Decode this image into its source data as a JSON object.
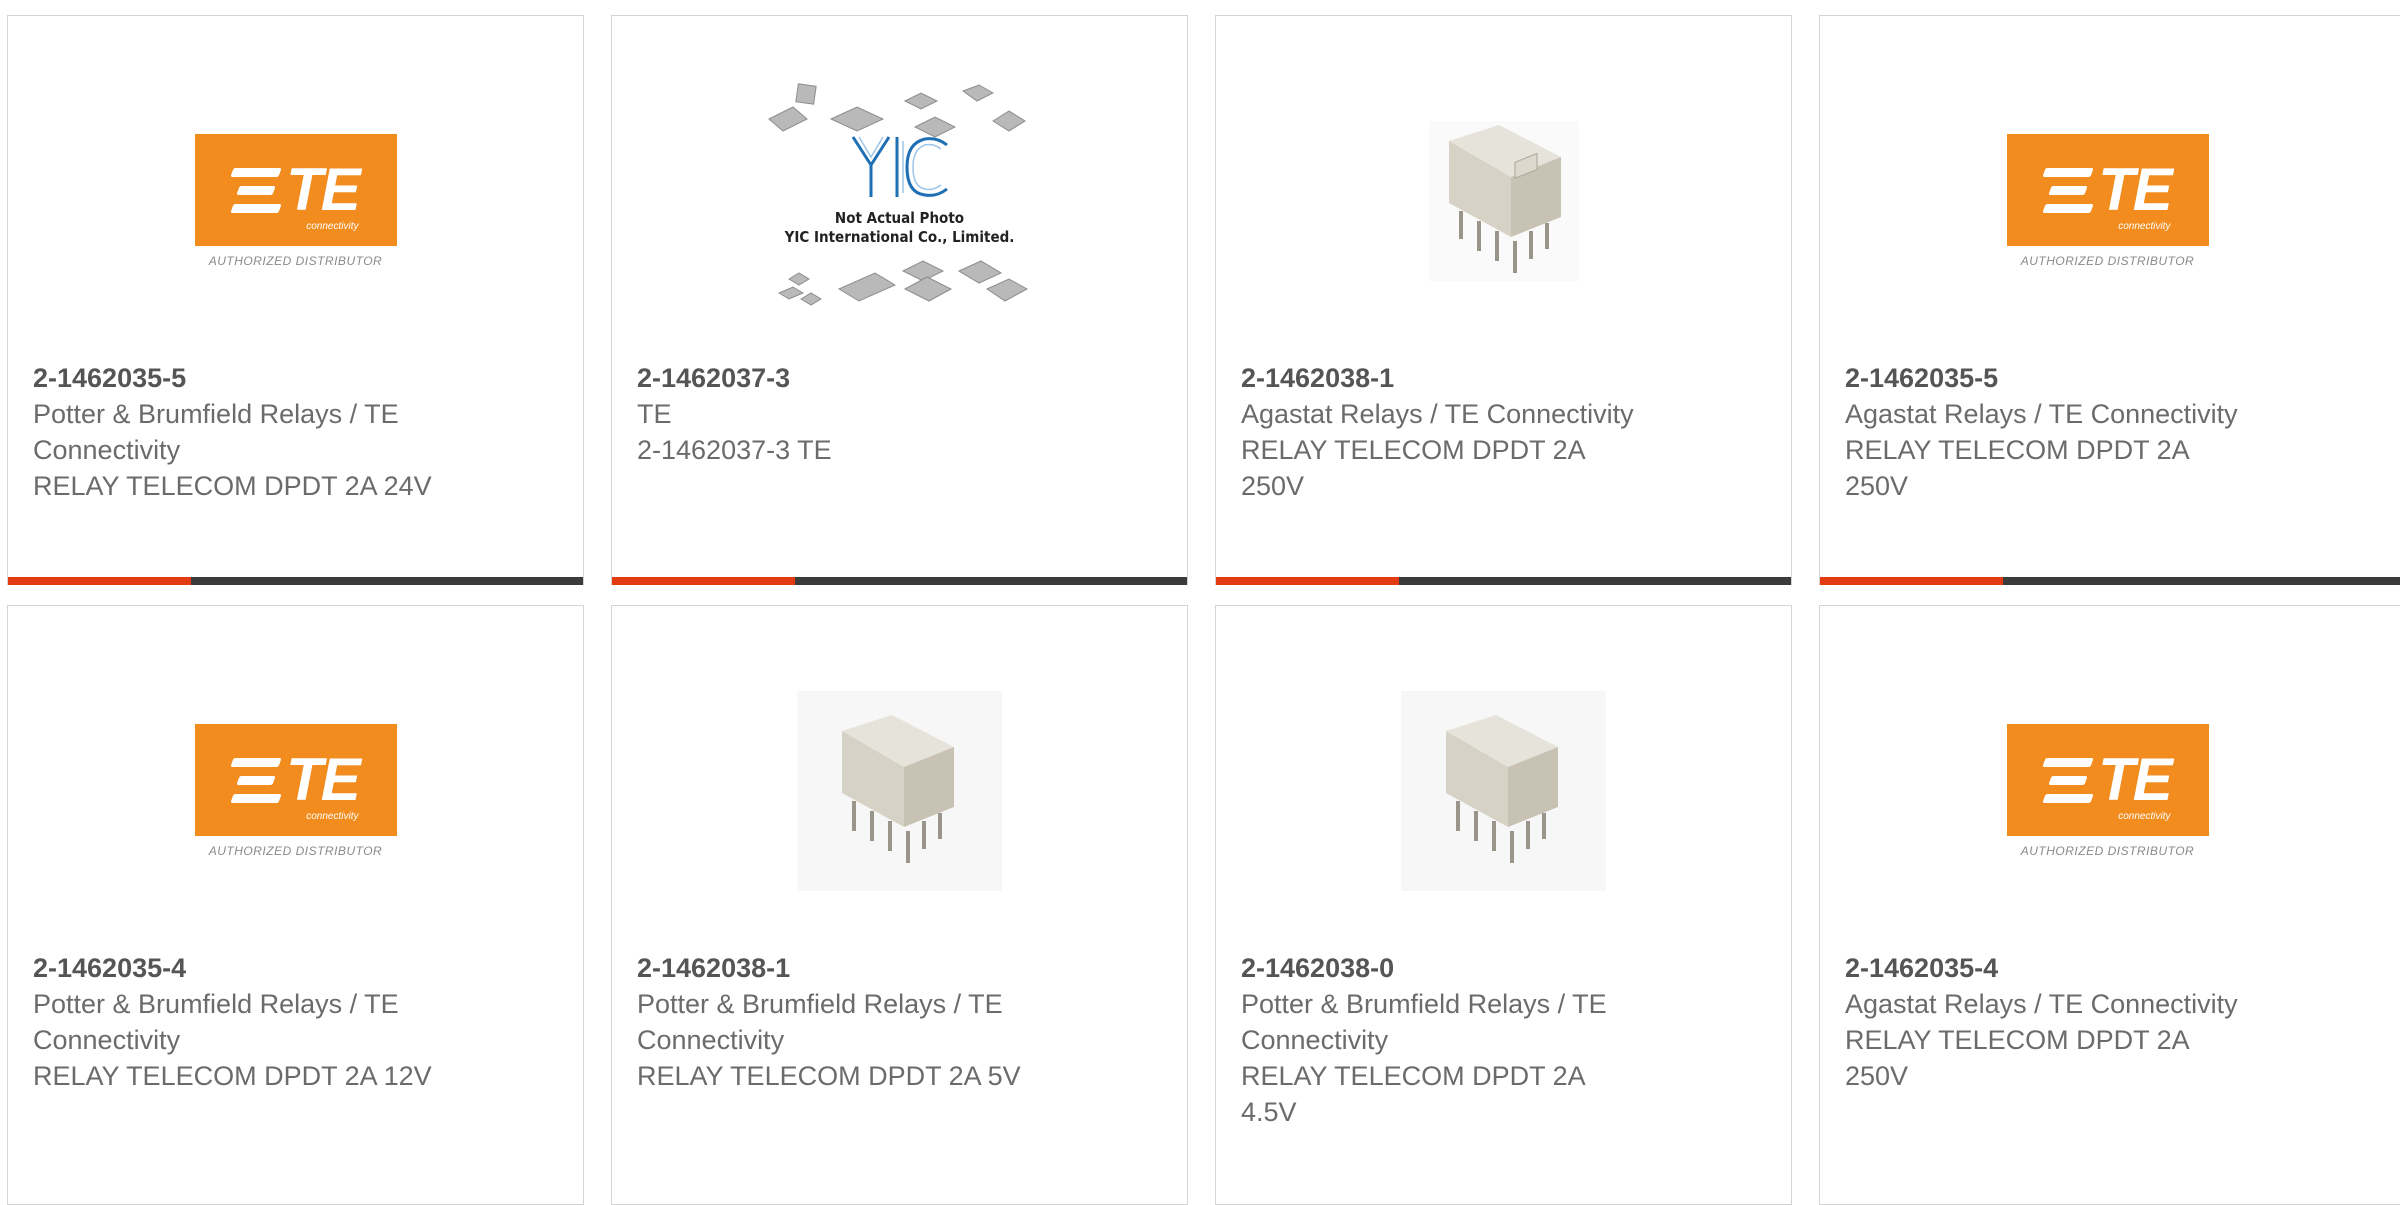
{
  "products": [
    {
      "part_number": "2-1462035-5",
      "manufacturer_line1": "Potter & Brumfield Relays / TE",
      "manufacturer_line2": "Connectivity",
      "desc_line1": "RELAY TELECOM DPDT 2A 24V",
      "desc_line2": "",
      "image": "te-authorized-logo"
    },
    {
      "part_number": "2-1462037-3",
      "manufacturer_line1": "TE",
      "manufacturer_line2": "",
      "desc_line1": "2-1462037-3 TE",
      "desc_line2": "",
      "image": "yic-placeholder"
    },
    {
      "part_number": "2-1462038-1",
      "manufacturer_line1": "Agastat Relays / TE Connectivity",
      "manufacturer_line2": "",
      "desc_line1": "RELAY TELECOM DPDT 2A",
      "desc_line2": "250V",
      "image": "relay-photo"
    },
    {
      "part_number": "2-1462035-5",
      "manufacturer_line1": "Agastat Relays / TE Connectivity",
      "manufacturer_line2": "",
      "desc_line1": "RELAY TELECOM DPDT 2A",
      "desc_line2": "250V",
      "image": "te-authorized-logo"
    },
    {
      "part_number": "2-1462035-4",
      "manufacturer_line1": "Potter & Brumfield Relays / TE",
      "manufacturer_line2": "Connectivity",
      "desc_line1": "RELAY TELECOM DPDT 2A 12V",
      "desc_line2": "",
      "image": "te-authorized-logo"
    },
    {
      "part_number": "2-1462038-1",
      "manufacturer_line1": "Potter & Brumfield Relays / TE",
      "manufacturer_line2": "Connectivity",
      "desc_line1": "RELAY TELECOM DPDT 2A 5V",
      "desc_line2": "",
      "image": "relay-photo"
    },
    {
      "part_number": "2-1462038-0",
      "manufacturer_line1": "Potter & Brumfield Relays / TE",
      "manufacturer_line2": "Connectivity",
      "desc_line1": "RELAY TELECOM DPDT 2A",
      "desc_line2": "4.5V",
      "image": "relay-photo"
    },
    {
      "part_number": "2-1462035-4",
      "manufacturer_line1": "Agastat Relays / TE Connectivity",
      "manufacturer_line2": "",
      "desc_line1": "RELAY TELECOM DPDT 2A",
      "desc_line2": "250V",
      "image": "te-authorized-logo"
    }
  ],
  "te_logo": {
    "letters": "TE",
    "sub": "connectivity",
    "caption": "AUTHORIZED DISTRIBUTOR"
  },
  "yic_logo": {
    "letters": "YIC",
    "note_line1": "Not Actual Photo",
    "note_line2": "YIC International Co., Limited."
  },
  "colors": {
    "accent": "#e33a12",
    "bar": "#3b3b3b",
    "te_orange": "#f28c1e",
    "yic_blue": "#1f6fb5"
  }
}
